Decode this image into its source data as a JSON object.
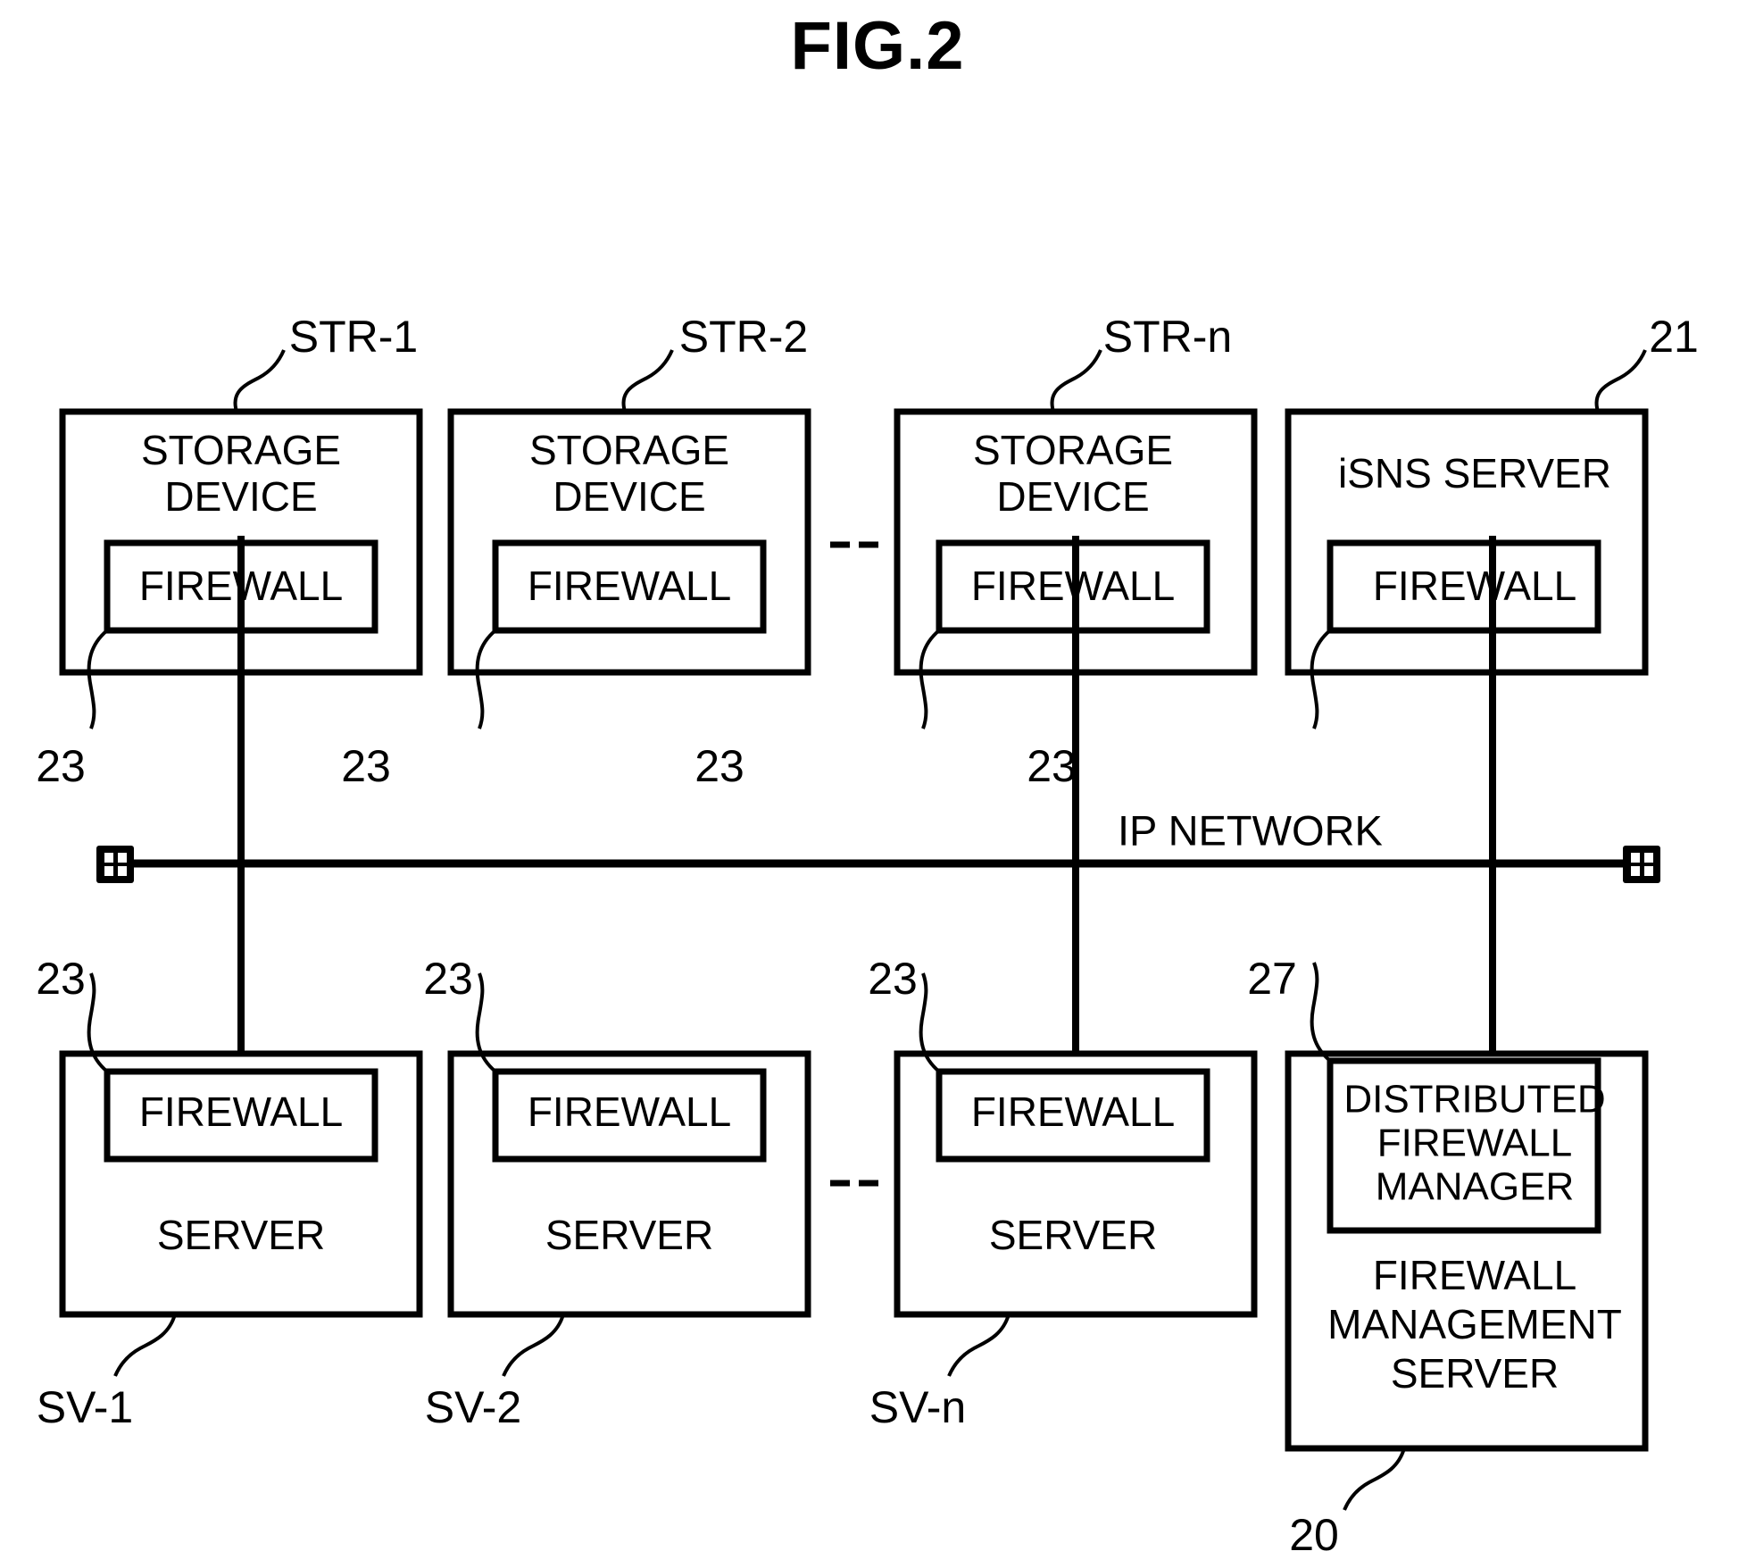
{
  "figure": {
    "title": "FIG.2"
  },
  "network": {
    "label": "IP NETWORK",
    "left_connector_icon": "network-jack-icon",
    "right_connector_icon": "network-jack-icon"
  },
  "top_row": {
    "ellipsis": "- - -",
    "nodes": [
      {
        "id": "str-1",
        "title_line1": "STORAGE",
        "title_line2": "DEVICE",
        "inner_label": "FIREWALL",
        "ref_top": "STR-1",
        "ref_bottom": "23"
      },
      {
        "id": "str-2",
        "title_line1": "STORAGE",
        "title_line2": "DEVICE",
        "inner_label": "FIREWALL",
        "ref_top": "STR-2",
        "ref_bottom": "23"
      },
      {
        "id": "str-n",
        "title_line1": "STORAGE",
        "title_line2": "DEVICE",
        "inner_label": "FIREWALL",
        "ref_top": "STR-n",
        "ref_bottom": "23"
      },
      {
        "id": "isns-server",
        "title_line1": "iSNS SERVER",
        "title_line2": "",
        "inner_label": "FIREWALL",
        "ref_top": "21",
        "ref_bottom": "23"
      }
    ]
  },
  "bottom_row": {
    "ellipsis": "- - -",
    "nodes": [
      {
        "id": "sv-1",
        "inner_label": "FIREWALL",
        "title_line1": "SERVER",
        "ref_top": "23",
        "ref_bottom": "SV-1"
      },
      {
        "id": "sv-2",
        "inner_label": "FIREWALL",
        "title_line1": "SERVER",
        "ref_top": "23",
        "ref_bottom": "SV-2"
      },
      {
        "id": "sv-n",
        "inner_label": "FIREWALL",
        "title_line1": "SERVER",
        "ref_top": "23",
        "ref_bottom": "SV-n"
      }
    ],
    "management_server": {
      "id": "firewall-management-server",
      "inner_line1": "DISTRIBUTED",
      "inner_line2": "FIREWALL",
      "inner_line3": "MANAGER",
      "title_line1": "FIREWALL",
      "title_line2": "MANAGEMENT",
      "title_line3": "SERVER",
      "ref_inner": "27",
      "ref_bottom": "20"
    }
  }
}
